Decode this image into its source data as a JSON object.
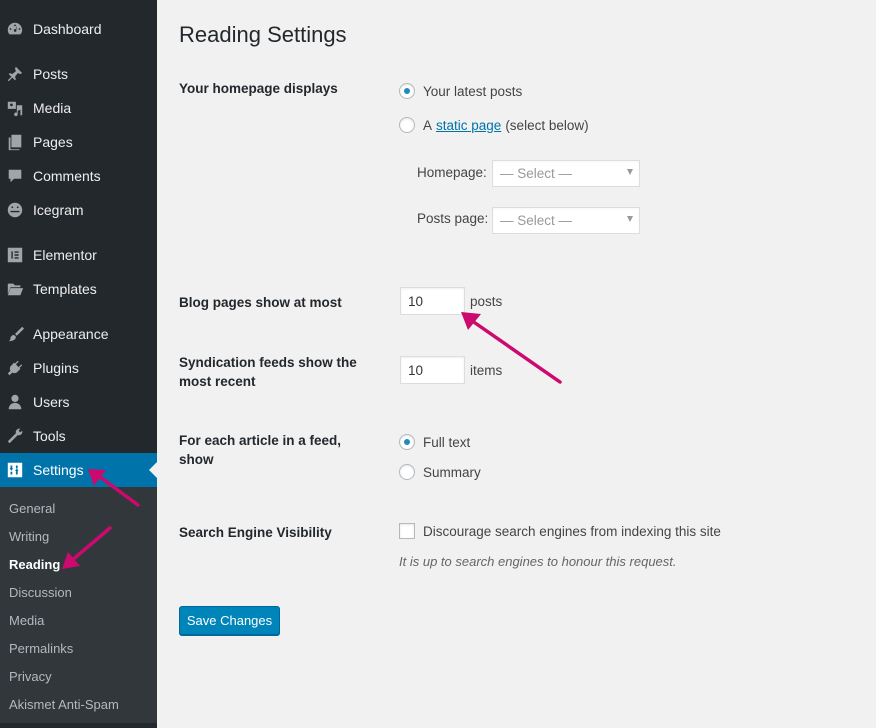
{
  "sidebar": {
    "items": [
      {
        "label": "Dashboard",
        "icon": "dashboard-icon"
      },
      {
        "label": "Posts",
        "icon": "pin-icon"
      },
      {
        "label": "Media",
        "icon": "media-icon"
      },
      {
        "label": "Pages",
        "icon": "pages-icon"
      },
      {
        "label": "Comments",
        "icon": "comment-icon"
      },
      {
        "label": "Icegram",
        "icon": "icegram-icon"
      },
      {
        "label": "Elementor",
        "icon": "elementor-icon"
      },
      {
        "label": "Templates",
        "icon": "folder-icon"
      },
      {
        "label": "Appearance",
        "icon": "paintbrush-icon"
      },
      {
        "label": "Plugins",
        "icon": "plug-icon"
      },
      {
        "label": "Users",
        "icon": "user-icon"
      },
      {
        "label": "Tools",
        "icon": "wrench-icon"
      },
      {
        "label": "Settings",
        "icon": "settings-icon",
        "active": true
      }
    ],
    "submenu": [
      {
        "label": "General"
      },
      {
        "label": "Writing"
      },
      {
        "label": "Reading",
        "current": true
      },
      {
        "label": "Discussion"
      },
      {
        "label": "Media"
      },
      {
        "label": "Permalinks"
      },
      {
        "label": "Privacy"
      },
      {
        "label": "Akismet Anti-Spam"
      }
    ]
  },
  "page": {
    "title": "Reading Settings",
    "homepage_displays": {
      "label": "Your homepage displays",
      "options": [
        {
          "label": "Your latest posts",
          "checked": true
        },
        {
          "prefix": "A",
          "link": "static page",
          "suffix": "(select below)",
          "checked": false
        }
      ],
      "homepage_select": {
        "label": "Homepage:",
        "value": "— Select —"
      },
      "posts_page_select": {
        "label": "Posts page:",
        "value": "— Select —"
      }
    },
    "blog_pages": {
      "label": "Blog pages show at most",
      "value": "10",
      "unit": "posts"
    },
    "syndication": {
      "label_line1": "Syndication feeds show the",
      "label_line2": "most recent",
      "value": "10",
      "unit": "items"
    },
    "feed_article": {
      "label": "For each article in a feed, show",
      "options": [
        {
          "label": "Full text",
          "checked": true
        },
        {
          "label": "Summary",
          "checked": false
        }
      ]
    },
    "search_visibility": {
      "label": "Search Engine Visibility",
      "checkbox_label": "Discourage search engines from indexing this site",
      "checked": false,
      "description": "It is up to search engines to honour this request."
    },
    "save_label": "Save Changes"
  },
  "annotations": {
    "arrow_color": "#cc0a6e"
  },
  "colors": {
    "sidebar_bg": "#23282d",
    "submenu_bg": "#32373c",
    "active_bg": "#0073aa",
    "button_bg": "#0085ba",
    "link": "#0073aa",
    "radio_dot": "#1e8cbe"
  }
}
